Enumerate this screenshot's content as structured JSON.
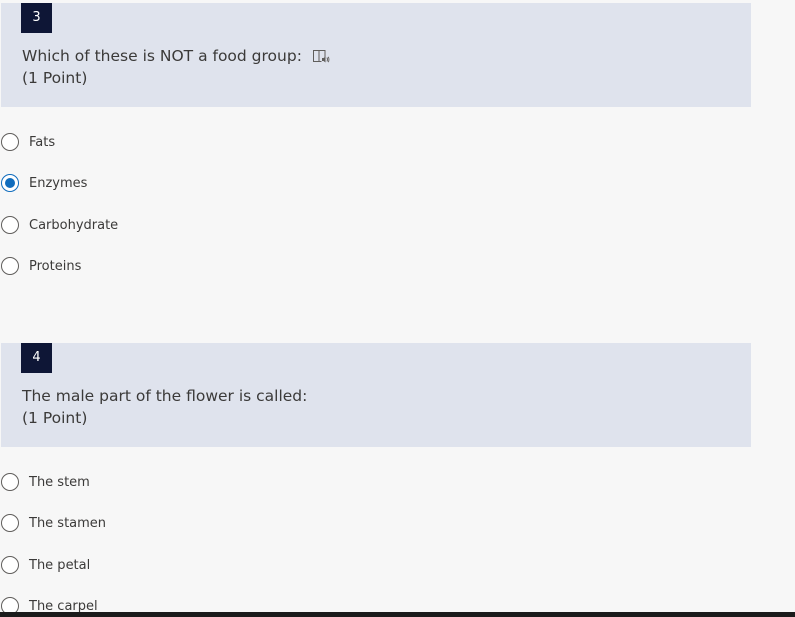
{
  "questions": [
    {
      "number": "3",
      "title": "Which of these is NOT a food group:",
      "points": "(1 Point)",
      "has_immersive_reader_icon": true,
      "options": [
        {
          "label": "Fats",
          "selected": false
        },
        {
          "label": "Enzymes",
          "selected": true
        },
        {
          "label": "Carbohydrate",
          "selected": false
        },
        {
          "label": "Proteins",
          "selected": false
        }
      ]
    },
    {
      "number": "4",
      "title": "The male part of the flower is called:",
      "points": "(1 Point)",
      "has_immersive_reader_icon": false,
      "options": [
        {
          "label": "The stem",
          "selected": false
        },
        {
          "label": "The stamen",
          "selected": false
        },
        {
          "label": "The petal",
          "selected": false
        },
        {
          "label": "The carpel",
          "selected": false
        }
      ]
    }
  ],
  "colors": {
    "header_bg": "#dfe3ed",
    "number_badge_bg": "#0e1636",
    "radio_selected": "#0f6cbd",
    "page_bg": "#f7f7f7"
  }
}
